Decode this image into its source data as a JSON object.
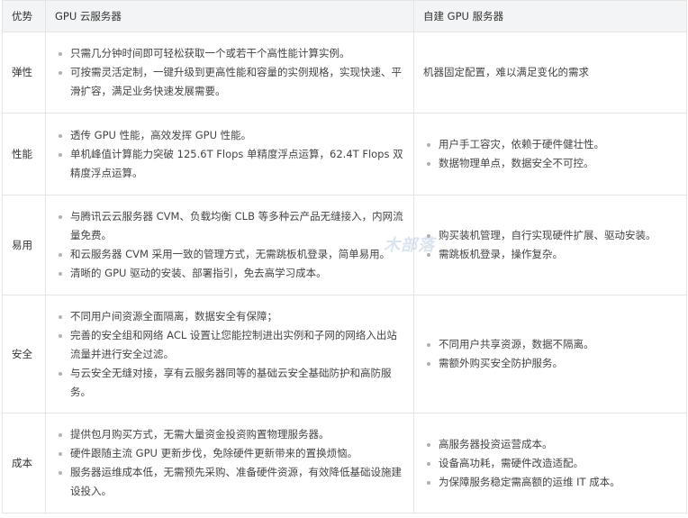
{
  "header": {
    "advantage": "优势",
    "cloud": "GPU 云服务器",
    "self_built": "自建 GPU 服务器"
  },
  "rows": [
    {
      "category": "弹性",
      "cloud": [
        "只需几分钟时间即可轻松获取一个或若干个高性能计算实例。",
        "可按需灵活定制，一键升级到更高性能和容量的实例规格，实现快速、平滑扩容，满足业务快速发展需要。"
      ],
      "self_text": "机器固定配置，难以满足变化的需求"
    },
    {
      "category": "性能",
      "cloud": [
        "透传 GPU 性能，高效发挥 GPU 性能。",
        "单机峰值计算能力突破 125.6T Flops 单精度浮点运算，62.4T Flops 双精度浮点运算。"
      ],
      "self": [
        "用户手工容灾，依赖于硬件健壮性。",
        "数据物理单点，数据安全不可控。"
      ]
    },
    {
      "category": "易用",
      "cloud": [
        "与腾讯云云服务器 CVM、负载均衡 CLB 等多种云产品无缝接入，内网流量免费。",
        "和云服务器 CVM 采用一致的管理方式，无需跳板机登录，简单易用。",
        "清晰的 GPU 驱动的安装、部署指引，免去高学习成本。"
      ],
      "self": [
        "购买装机管理，自行实现硬件扩展、驱动安装。",
        "需跳板机登录，操作复杂。"
      ]
    },
    {
      "category": "安全",
      "cloud": [
        "不同用户间资源全面隔离，数据安全有保障；",
        "完善的安全组和网络 ACL 设置让您能控制进出实例和子网的网络入出站流量并进行安全过滤。",
        "与云安全无缝对接，享有云服务器同等的基础云安全基础防护和高防服务。"
      ],
      "self": [
        "不同用户共享资源，数据不隔离。",
        "需额外购买安全防护服务。"
      ]
    },
    {
      "category": "成本",
      "cloud": [
        "提供包月购买方式，无需大量资金投资购置物理服务器。",
        "硬件跟随主流 GPU 更新步伐，免除硬件更新带来的置换烦恼。",
        "服务器运维成本低，无需预先采购、准备硬件资源，有效降低基础设施建设投入。"
      ],
      "self": [
        "高服务器投资运营成本。",
        "设备高功耗，需硬件改造适配。",
        "为保障服务稳定需高额的运维 IT 成本。"
      ]
    }
  ],
  "watermark": "木部落"
}
